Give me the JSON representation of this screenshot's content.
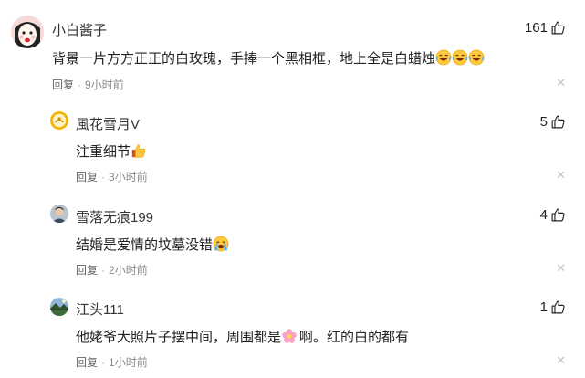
{
  "comments": [
    {
      "username": "小白酱子",
      "text": "背景一片方方正正的白玫瑰，手捧一个黑相框，地上全是白蜡烛",
      "reply_label": "回复",
      "time": "9小时前",
      "likes": "161",
      "emoji": [
        "crying-laughing-face-icon",
        "crying-laughing-face-icon",
        "crying-laughing-face-icon"
      ]
    },
    {
      "username": "風花雪月V",
      "text": "注重细节",
      "reply_label": "回复",
      "time": "3小时前",
      "likes": "5",
      "emoji": [
        "thumbs-up-icon"
      ]
    },
    {
      "username": "雪落无痕199",
      "text": "结婚是爱情的坟墓没错",
      "reply_label": "回复",
      "time": "2小时前",
      "likes": "4",
      "emoji": [
        "crying-face-icon"
      ]
    },
    {
      "username": "江头111",
      "text_before": "他姥爷大照片子摆中间，周围都是",
      "text_after": "啊。红的白的都有",
      "reply_label": "回复",
      "time": "1小时前",
      "likes": "1",
      "emoji": [
        "flower-icon"
      ]
    }
  ],
  "colors": {
    "text": "#222222",
    "meta": "#8a8a8a",
    "close": "#c3c3c3"
  }
}
